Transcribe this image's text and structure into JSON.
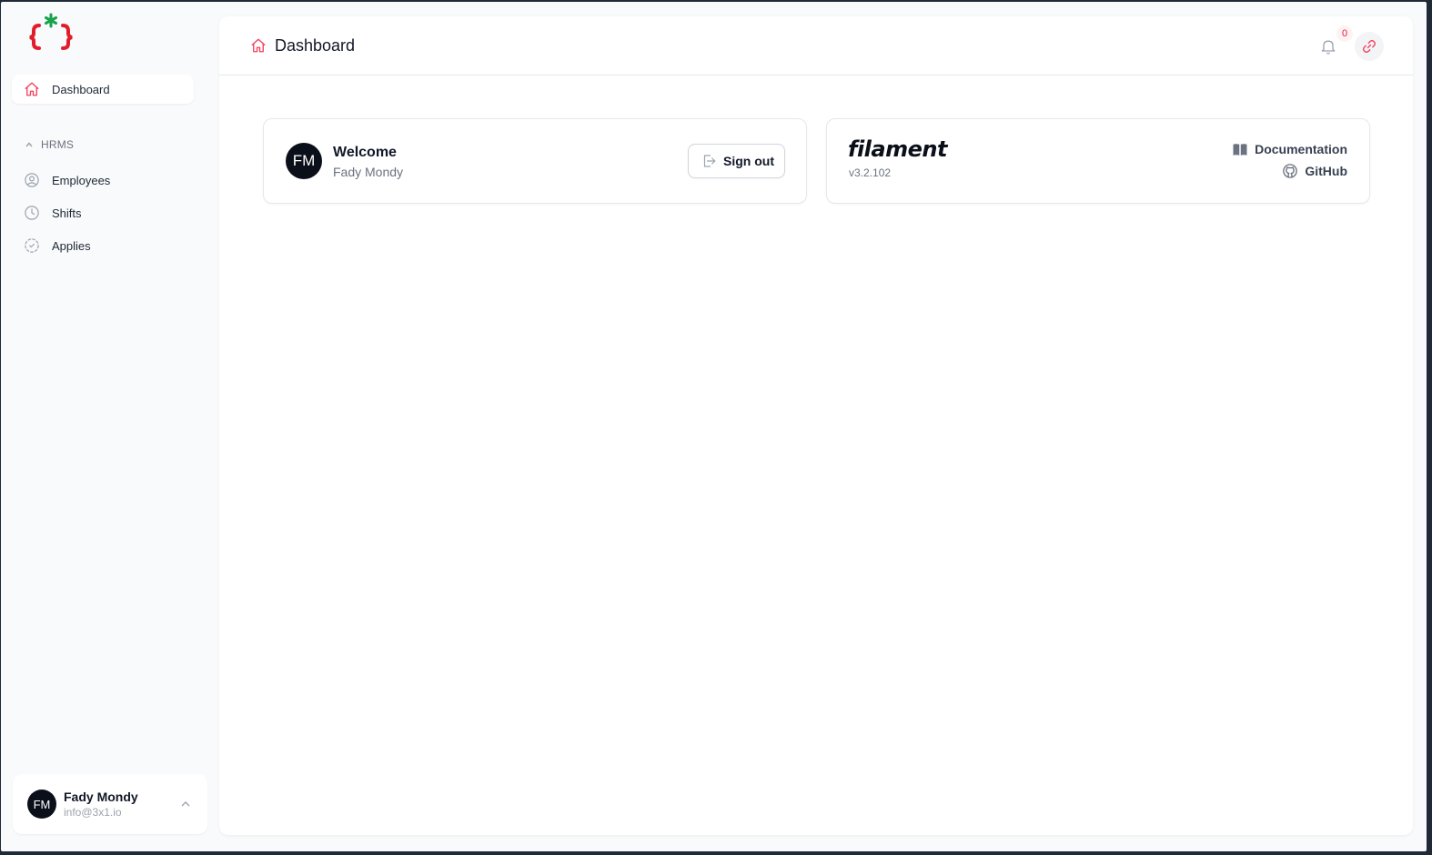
{
  "colors": {
    "accent": "#f43f5e",
    "brand_green": "#16a34a",
    "brand_red": "#e11d2a",
    "text_muted": "#6b7280"
  },
  "sidebar": {
    "logo_icon": "curly-braces-asterisk-logo",
    "items": [
      {
        "label": "Dashboard",
        "icon": "home-icon",
        "active": true
      }
    ],
    "group": {
      "label": "HRMS",
      "items": [
        {
          "label": "Employees",
          "icon": "user-circle-icon"
        },
        {
          "label": "Shifts",
          "icon": "clock-icon"
        },
        {
          "label": "Applies",
          "icon": "dashed-circle-icon"
        }
      ]
    },
    "user": {
      "initials": "FM",
      "name": "Fady Mondy",
      "email": "info@3x1.io"
    }
  },
  "header": {
    "title": "Dashboard",
    "notifications_count": "0"
  },
  "welcome_card": {
    "initials": "FM",
    "title": "Welcome",
    "name": "Fady Mondy",
    "signout_label": "Sign out"
  },
  "filament_card": {
    "logo_text": "filament",
    "version": "v3.2.102",
    "docs_label": "Documentation",
    "github_label": "GitHub"
  }
}
